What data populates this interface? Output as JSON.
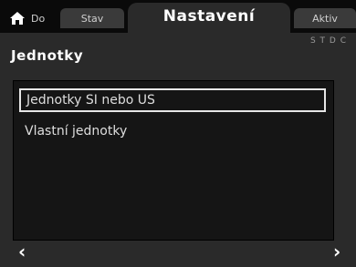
{
  "tabs": {
    "home": "Do",
    "stav": "Stav",
    "active": "Nastavení",
    "right": "Aktiv"
  },
  "subtitle": "S T D C",
  "page": {
    "title": "Jednotky"
  },
  "list": {
    "items": [
      {
        "label": "Jednotky SI nebo US",
        "selected": true
      },
      {
        "label": "Vlastní jednotky",
        "selected": false
      }
    ]
  },
  "nav": {
    "prev": "‹",
    "next": "›"
  },
  "icons": {
    "home": "home-icon"
  },
  "colors": {
    "background": "#2a2a2a",
    "topbar": "#0a0a0a",
    "list_bg": "#151515",
    "selection_border": "#e6e6e6"
  }
}
